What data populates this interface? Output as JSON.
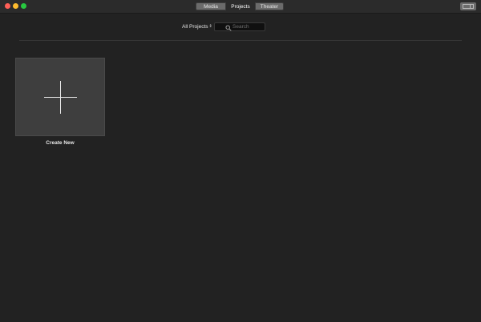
{
  "toolbar": {
    "tabs": [
      {
        "label": "Media"
      },
      {
        "label": "Projects"
      },
      {
        "label": "Theater"
      }
    ],
    "selected_tab": "Projects"
  },
  "filter": {
    "selected": "All Projects",
    "search_placeholder": "Search"
  },
  "projects": {
    "create_new_label": "Create New"
  },
  "colors": {
    "background": "#222222",
    "close": "#fe5f57",
    "minimize": "#febc2e",
    "maximize": "#28c840",
    "tile": "#3e3e3e"
  }
}
